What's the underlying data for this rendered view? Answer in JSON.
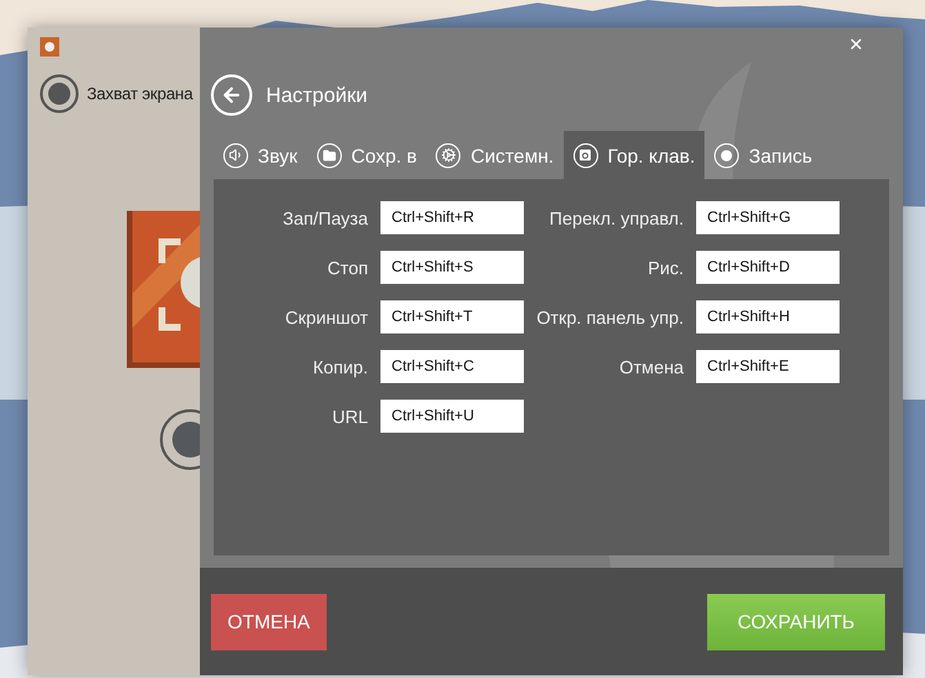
{
  "capture_mode": {
    "label": "Захват экрана",
    "selected": true
  },
  "settings": {
    "title": "Настройки",
    "tabs": [
      {
        "kind": "sound",
        "label": "Звук",
        "selected": false
      },
      {
        "kind": "folder",
        "label": "Сохр. в",
        "selected": false
      },
      {
        "kind": "system",
        "label": "Системн.",
        "selected": false
      },
      {
        "kind": "keyboard",
        "label": "Гор. клав.",
        "selected": true
      },
      {
        "kind": "record",
        "label": "Запись",
        "selected": false
      }
    ],
    "hotkeys_left": [
      {
        "label": "Зап/Пауза",
        "value": "Ctrl+Shift+R"
      },
      {
        "label": "Стоп",
        "value": "Ctrl+Shift+S"
      },
      {
        "label": "Скриншот",
        "value": "Ctrl+Shift+T"
      },
      {
        "label": "Копир.",
        "value": "Ctrl+Shift+C"
      },
      {
        "label": "URL",
        "value": "Ctrl+Shift+U"
      }
    ],
    "hotkeys_right": [
      {
        "label": "Перекл. управл.",
        "value": "Ctrl+Shift+G"
      },
      {
        "label": "Рис.",
        "value": "Ctrl+Shift+D"
      },
      {
        "label": "Откр. панель упр.",
        "value": "Ctrl+Shift+H"
      },
      {
        "label": "Отмена",
        "value": "Ctrl+Shift+E"
      }
    ],
    "buttons": [
      {
        "kind": "cancel",
        "label": "ОТМЕНА"
      },
      {
        "kind": "save",
        "label": "СОХРАНИТЬ"
      }
    ]
  }
}
